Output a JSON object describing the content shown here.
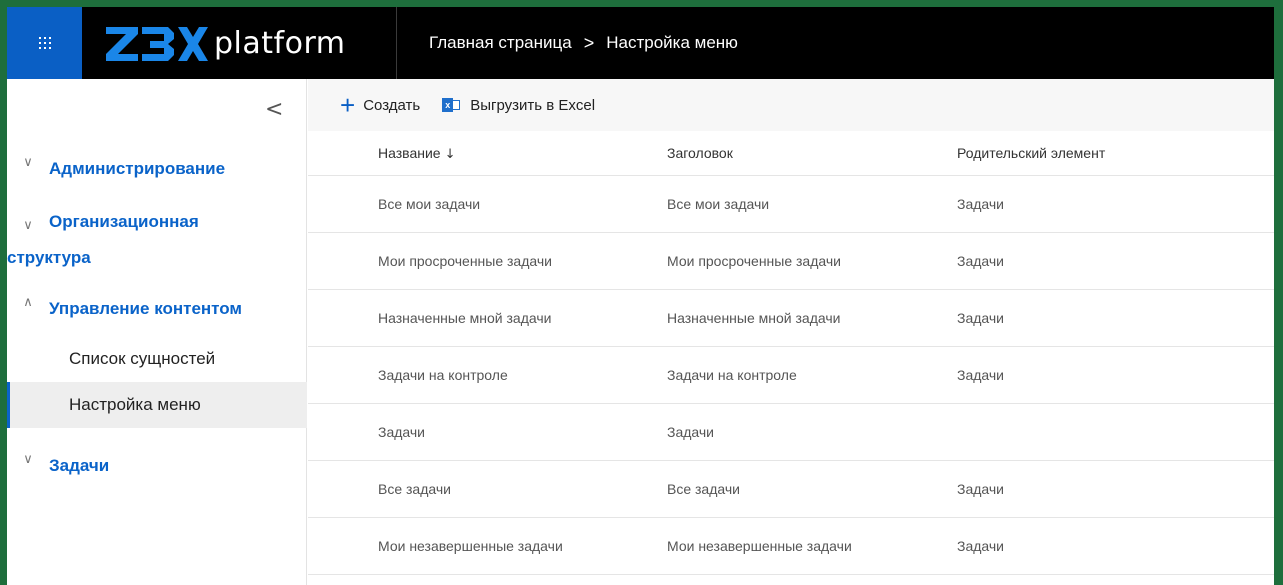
{
  "topbar": {
    "logo_text": "platform",
    "breadcrumb": [
      "Главная страница",
      "Настройка меню"
    ],
    "separator": ">"
  },
  "sidebar": {
    "collapse_glyph": "<",
    "groups": [
      {
        "label": "Администрирование",
        "chevron": "∨"
      },
      {
        "label_line1": "Организационная",
        "label_line2": "структура",
        "chevron": "∨"
      },
      {
        "label": "Управление контентом",
        "chevron": "∧"
      },
      {
        "label": "Задачи",
        "chevron": "∨"
      }
    ],
    "sub_items": [
      "Список сущностей",
      "Настройка меню"
    ]
  },
  "toolbar": {
    "create_label": "Создать",
    "export_label": "Выгрузить в Excel"
  },
  "table": {
    "columns": [
      "Название",
      "Заголовок",
      "Родительский элемент"
    ],
    "sort_indicator": "↓",
    "rows": [
      [
        "Все мои задачи",
        "Все мои задачи",
        "Задачи"
      ],
      [
        "Мои просроченные задачи",
        "Мои просроченные задачи",
        "Задачи"
      ],
      [
        "Назначенные мной задачи",
        "Назначенные мной задачи",
        "Задачи"
      ],
      [
        "Задачи на контроле",
        "Задачи на контроле",
        "Задачи"
      ],
      [
        "Задачи",
        "Задачи",
        ""
      ],
      [
        "Все задачи",
        "Все задачи",
        "Задачи"
      ],
      [
        "Мои незавершенные задачи",
        "Мои незавершенные задачи",
        "Задачи"
      ]
    ]
  },
  "colors": {
    "accent": "#0a63c9",
    "frame": "#1e6e3c",
    "topbar": "#000000",
    "waffle": "#0a5fc5"
  }
}
